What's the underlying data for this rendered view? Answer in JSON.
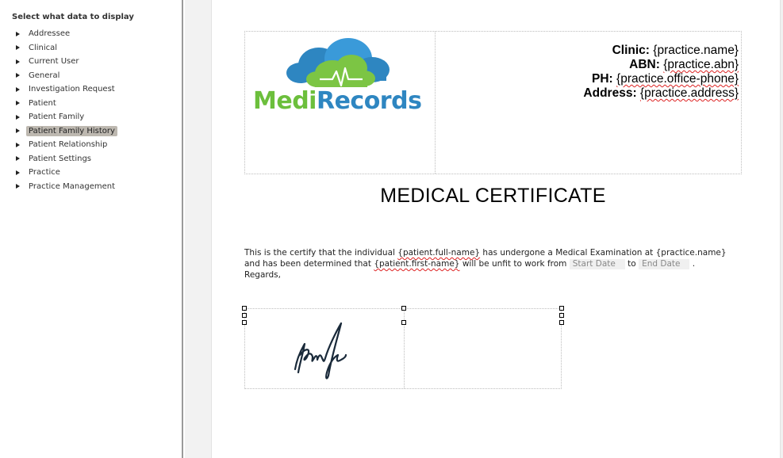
{
  "panel": {
    "title": "Select what data to display",
    "items": [
      {
        "label": "Addressee"
      },
      {
        "label": "Clinical"
      },
      {
        "label": "Current User"
      },
      {
        "label": "General"
      },
      {
        "label": "Investigation Request"
      },
      {
        "label": "Patient"
      },
      {
        "label": "Patient Family"
      },
      {
        "label": "Patient Family History"
      },
      {
        "label": "Patient Relationship"
      },
      {
        "label": "Patient Settings"
      },
      {
        "label": "Practice"
      },
      {
        "label": "Practice Management"
      }
    ],
    "selected_item": "Patient Family History"
  },
  "logo": {
    "part1": "Medi",
    "part2": "Records",
    "colors": {
      "green": "#6cbf3c",
      "blue": "#2e86c1"
    }
  },
  "header": {
    "clinic_label": "Clinic:",
    "clinic_value": "{practice.name}",
    "abn_label": "ABN:",
    "abn_value": "{practice.abn}",
    "ph_label": "PH:",
    "ph_value": "{practice.office-phone}",
    "address_label": "Address:",
    "address_value": "{practice.address}"
  },
  "document": {
    "title": "MEDICAL CERTIFICATE",
    "line1_a": "This is the certify that the individual ",
    "line1_field1": "{patient.full-name}",
    "line1_b": " has undergone a Medical Examination at {practice.name}",
    "line2_a": "and has been determined that ",
    "line2_field": "{patient.first-name}",
    "line2_b": " will be unfit to work from ",
    "start_date": "Start Date",
    "to_text": " to ",
    "end_date": "End Date",
    "line2_end": " .",
    "regards": "Regards,"
  }
}
